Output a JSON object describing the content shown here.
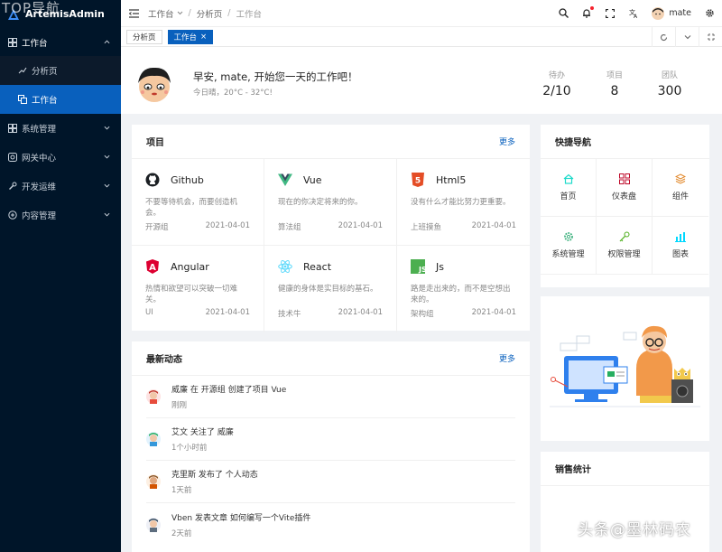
{
  "watermark_top": "TOP导航",
  "watermark_bottom": "头条@墨林码农",
  "app": {
    "name": "ArtemisAdmin"
  },
  "sidebar": {
    "items": [
      {
        "label": "工作台",
        "icon": "dashboard-icon",
        "expanded": true
      },
      {
        "label": "系统管理",
        "icon": "grid-icon"
      },
      {
        "label": "网关中心",
        "icon": "gateway-icon"
      },
      {
        "label": "开发运维",
        "icon": "tool-icon"
      },
      {
        "label": "内容管理",
        "icon": "content-icon"
      }
    ],
    "subitems": [
      {
        "label": "分析页",
        "icon": "trend-icon"
      },
      {
        "label": "工作台",
        "icon": "copy-icon",
        "active": true
      }
    ]
  },
  "header": {
    "breadcrumbs": [
      "工作台",
      "分析页",
      "工作台"
    ],
    "username": "mate"
  },
  "tabs": [
    {
      "label": "分析页"
    },
    {
      "label": "工作台",
      "close": "×",
      "active": true
    }
  ],
  "welcome": {
    "greeting": "早安, mate, 开始您一天的工作吧！",
    "weather": "今日晴，20°C - 32°C!",
    "stats": [
      {
        "label": "待办",
        "value": "2/10"
      },
      {
        "label": "项目",
        "value": "8"
      },
      {
        "label": "团队",
        "value": "300"
      }
    ]
  },
  "projects": {
    "title": "项目",
    "more": "更多",
    "items": [
      {
        "name": "Github",
        "icon": "github-icon",
        "desc": "不要等待机会，而要创造机会。",
        "group": "开源组",
        "date": "2021-04-01"
      },
      {
        "name": "Vue",
        "icon": "vue-icon",
        "desc": "现在的你决定将来的你。",
        "group": "算法组",
        "date": "2021-04-01"
      },
      {
        "name": "Html5",
        "icon": "html5-icon",
        "desc": "没有什么才能比努力更重要。",
        "group": "上班摸鱼",
        "date": "2021-04-01"
      },
      {
        "name": "Angular",
        "icon": "angular-icon",
        "desc": "热情和欲望可以突破一切难关。",
        "group": "UI",
        "date": "2021-04-01"
      },
      {
        "name": "React",
        "icon": "react-icon",
        "desc": "健康的身体是实目标的基石。",
        "group": "技术牛",
        "date": "2021-04-01"
      },
      {
        "name": "Js",
        "icon": "js-icon",
        "desc": "路是走出来的，而不是空想出来的。",
        "group": "架构组",
        "date": "2021-04-01"
      }
    ]
  },
  "activity": {
    "title": "最新动态",
    "more": "更多",
    "items": [
      {
        "text": "威廉 在 开源组 创建了项目 Vue",
        "time": "刚刚"
      },
      {
        "text": "艾文 关注了 威廉",
        "time": "1个小时前"
      },
      {
        "text": "克里斯 发布了 个人动态",
        "time": "1天前"
      },
      {
        "text": "Vben 发表文章 如何编写一个Vite插件",
        "time": "2天前"
      }
    ]
  },
  "quicknav": {
    "title": "快捷导航",
    "items": [
      {
        "label": "首页",
        "icon": "home-icon",
        "color": "#1fdaca"
      },
      {
        "label": "仪表盘",
        "icon": "dashboard-grid-icon",
        "color": "#bf0c2c"
      },
      {
        "label": "组件",
        "icon": "layers-icon",
        "color": "#e18525"
      },
      {
        "label": "系统管理",
        "icon": "settings-icon",
        "color": "#3fb27f"
      },
      {
        "label": "权限管理",
        "icon": "key-icon",
        "color": "#4daf1bc9"
      },
      {
        "label": "图表",
        "icon": "chart-icon",
        "color": "#00d8ff"
      }
    ]
  },
  "sales": {
    "title": "销售统计"
  },
  "colors": {
    "primary": "#0960bd",
    "sidebar": "#001529"
  }
}
